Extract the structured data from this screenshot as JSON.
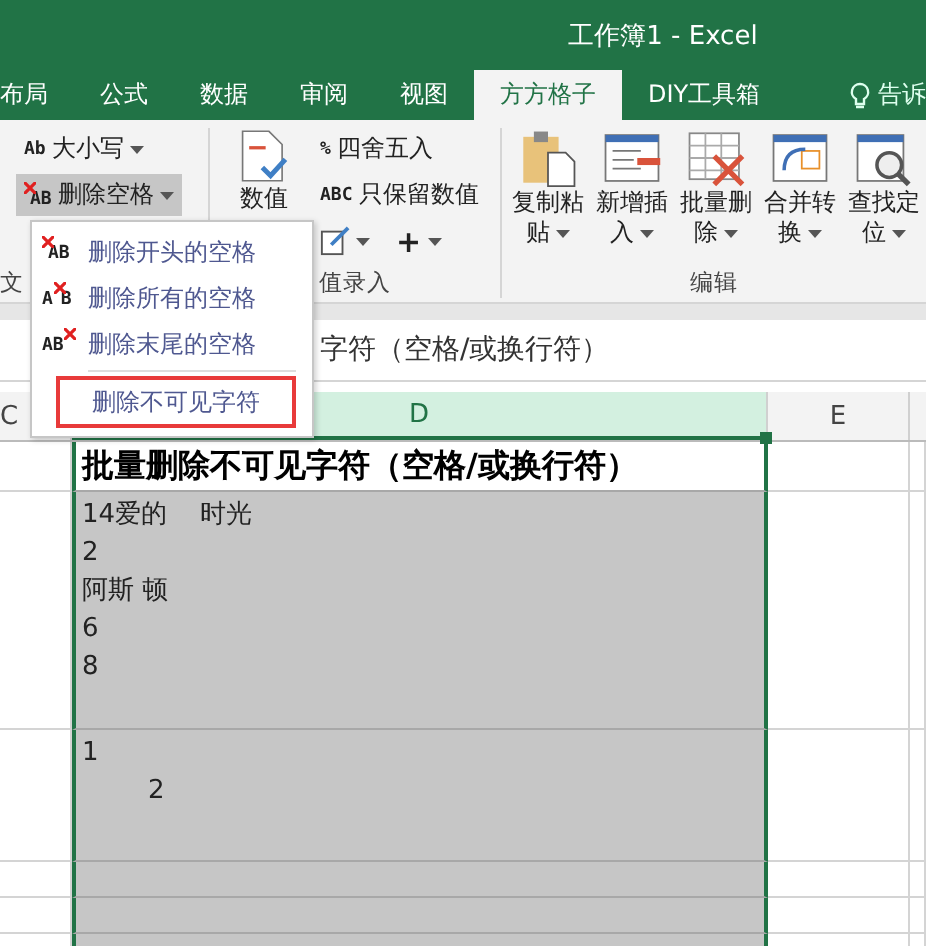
{
  "window": {
    "title": "工作簿1 - Excel"
  },
  "tabs": [
    {
      "label": "布局",
      "selected": false
    },
    {
      "label": "公式",
      "selected": false
    },
    {
      "label": "数据",
      "selected": false
    },
    {
      "label": "审阅",
      "selected": false
    },
    {
      "label": "视图",
      "selected": false
    },
    {
      "label": "方方格子",
      "selected": true
    },
    {
      "label": "DIY工具箱",
      "selected": false
    }
  ],
  "tell_me": {
    "label": "告诉"
  },
  "text_group": {
    "label": "文",
    "items": [
      {
        "icon_text": "Ab",
        "label": "大小写",
        "pressed": false
      },
      {
        "icon_text": "AB",
        "label": "删除空格",
        "pressed": true
      }
    ]
  },
  "number_group": {
    "label": "值录入",
    "big_button": {
      "label": "数值"
    },
    "items": [
      {
        "icon_text": "%",
        "label": "四舍五入"
      },
      {
        "icon_text": "ABC",
        "label": "只保留数值"
      }
    ],
    "plus": "+"
  },
  "edit_group": {
    "label": "编辑",
    "buttons": [
      {
        "kind": "clipboard",
        "line1": "复制粘",
        "line2": "贴"
      },
      {
        "kind": "insert",
        "line1": "新增插",
        "line2": "入"
      },
      {
        "kind": "delete",
        "line1": "批量删",
        "line2": "除"
      },
      {
        "kind": "merge",
        "line1": "合并转",
        "line2": "换"
      },
      {
        "kind": "find",
        "line1": "查找定",
        "line2": "位"
      }
    ]
  },
  "menu": {
    "items": [
      {
        "icon_text": "AB",
        "kind": "left",
        "label": "删除开头的空格",
        "outlined": false
      },
      {
        "icon_text": "AB",
        "kind": "middle",
        "label": "删除所有的空格",
        "outlined": false
      },
      {
        "icon_text": "AB",
        "kind": "right",
        "label": "删除末尾的空格",
        "outlined": false
      },
      {
        "label": "删除不可见字符",
        "outlined": true
      }
    ]
  },
  "formula_bar": {
    "value": "字符（空格/或换行符）"
  },
  "columns": [
    {
      "label": "C",
      "selected": false
    },
    {
      "label": "D",
      "selected": true
    },
    {
      "label": "E",
      "selected": false
    }
  ],
  "cells": {
    "title": "批量删除不可见字符（空格/或换行符）",
    "block_1": [
      "14爱的    时光",
      "2",
      "阿斯 顿",
      "6",
      "8"
    ],
    "block_2": [
      "1",
      "        2"
    ]
  }
}
